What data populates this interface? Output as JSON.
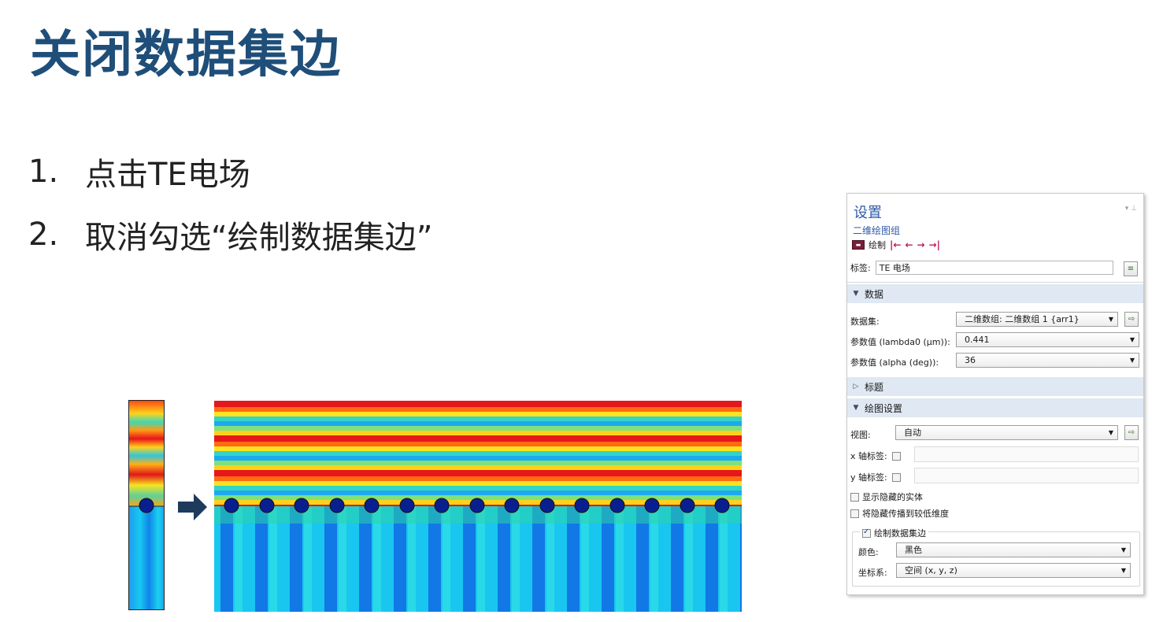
{
  "slide": {
    "title": "关闭数据集边",
    "steps": [
      {
        "num": "1.",
        "text": "点击TE电场"
      },
      {
        "num": "2.",
        "text": "取消勾选“绘制数据集边”"
      }
    ]
  },
  "figure": {
    "arrow_icon": "right-arrow-icon",
    "unit_cell": "field-plot-unit-cell",
    "full_field": "field-plot-extended"
  },
  "panel": {
    "title": "设置",
    "subtitle": "二维绘图组",
    "toolbar": {
      "plot_label": "绘制",
      "icons": [
        "plot-icon",
        "first-icon",
        "previous-icon",
        "next-icon",
        "last-icon"
      ]
    },
    "label_field": {
      "label": "标签:",
      "value": "TE 电场"
    },
    "sections": {
      "data": "数据",
      "title": "标题",
      "plot_settings": "绘图设置"
    },
    "data": {
      "dataset_label": "数据集:",
      "dataset_value": "二维数组: 二维数组 1 {arr1}",
      "param1_label": "参数值 (lambda0 (μm)):",
      "param1_value": "0.441",
      "param2_label": "参数值 (alpha (deg)):",
      "param2_value": "36"
    },
    "plot_settings": {
      "view_label": "视图:",
      "view_value": "自动",
      "x_axis_label": "x 轴标签:",
      "y_axis_label": "y 轴标签:",
      "show_hidden_label": "显示隐藏的实体",
      "propagate_hidden_label": "将隐藏传播到较低维度",
      "draw_edges_label": "绘制数据集边",
      "draw_edges_checked": true,
      "color_label": "颜色:",
      "color_value": "黑色",
      "frame_label": "坐标系:",
      "frame_value": "空间  (x, y, z)"
    }
  },
  "colors": {
    "title": "#1f4e79",
    "panel_accent": "#2e5aa8",
    "section_bg": "#dfe8f3",
    "nav_icons": "#c2185b",
    "arrow": "#1f3b5c"
  }
}
